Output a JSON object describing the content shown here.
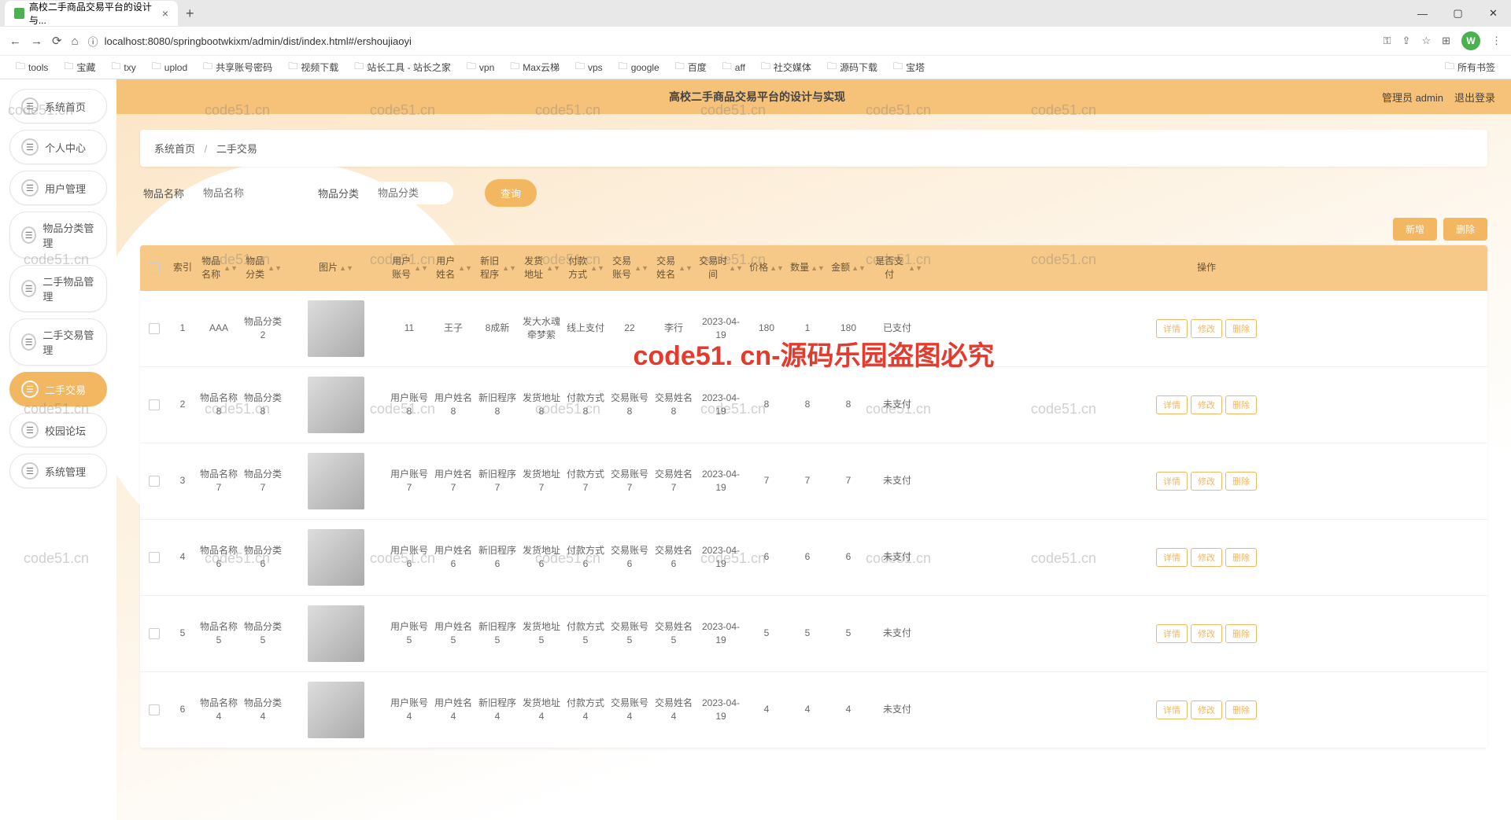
{
  "browser": {
    "tab_title": "高校二手商品交易平台的设计与...",
    "new_tab": "+",
    "url": "localhost:8080/springbootwkixm/admin/dist/index.html#/ershoujiaoyi",
    "avatar_letter": "W",
    "bookmarks": [
      "tools",
      "宝藏",
      "txy",
      "uplod",
      "共享账号密码",
      "视频下载",
      "站长工具 - 站长之家",
      "vpn",
      "Max云梯",
      "vps",
      "google",
      "百度",
      "aff",
      "社交媒体",
      "源码下载",
      "宝塔"
    ],
    "all_bookmarks": "所有书签"
  },
  "header": {
    "title": "高校二手商品交易平台的设计与实现",
    "admin_label": "管理员 admin",
    "logout": "退出登录"
  },
  "sidebar": {
    "items": [
      {
        "label": "系统首页"
      },
      {
        "label": "个人中心"
      },
      {
        "label": "用户管理"
      },
      {
        "label": "物品分类管理"
      },
      {
        "label": "二手物品管理"
      },
      {
        "label": "二手交易管理"
      },
      {
        "label": "二手交易"
      },
      {
        "label": "校园论坛"
      },
      {
        "label": "系统管理"
      }
    ],
    "active_index": 6
  },
  "breadcrumb": {
    "home": "系统首页",
    "current": "二手交易",
    "sep": "/"
  },
  "filters": {
    "name_label": "物品名称",
    "name_placeholder": "物品名称",
    "cat_label": "物品分类",
    "cat_placeholder": "物品分类",
    "search": "查询"
  },
  "actions": {
    "add": "新增",
    "delete": "删除"
  },
  "table": {
    "cols": {
      "idx": "索引",
      "name": "物品名称",
      "cat": "物品分类",
      "img": "图片",
      "acc": "用户账号",
      "uname": "用户姓名",
      "cond": "新旧程序",
      "addr": "发货地址",
      "pay": "付款方式",
      "tacc": "交易账号",
      "tname": "交易姓名",
      "time": "交易时间",
      "price": "价格",
      "qty": "数量",
      "amt": "金额",
      "paid": "是否支付",
      "op": "操作"
    },
    "op_btns": {
      "detail": "详情",
      "edit": "修改",
      "del": "删除"
    },
    "rows": [
      {
        "idx": "1",
        "name": "AAA",
        "cat": "物品分类2",
        "acc": "11",
        "uname": "王子",
        "cond": "8成新",
        "addr": "发大水魂牵梦萦",
        "pay": "线上支付",
        "tacc": "22",
        "tname": "李行",
        "time": "2023-04-19",
        "price": "180",
        "qty": "1",
        "amt": "180",
        "paid": "已支付"
      },
      {
        "idx": "2",
        "name": "物品名称8",
        "cat": "物品分类8",
        "acc": "用户账号8",
        "uname": "用户姓名8",
        "cond": "新旧程序8",
        "addr": "发货地址8",
        "pay": "付款方式8",
        "tacc": "交易账号8",
        "tname": "交易姓名8",
        "time": "2023-04-19",
        "price": "8",
        "qty": "8",
        "amt": "8",
        "paid": "未支付"
      },
      {
        "idx": "3",
        "name": "物品名称7",
        "cat": "物品分类7",
        "acc": "用户账号7",
        "uname": "用户姓名7",
        "cond": "新旧程序7",
        "addr": "发货地址7",
        "pay": "付款方式7",
        "tacc": "交易账号7",
        "tname": "交易姓名7",
        "time": "2023-04-19",
        "price": "7",
        "qty": "7",
        "amt": "7",
        "paid": "未支付"
      },
      {
        "idx": "4",
        "name": "物品名称6",
        "cat": "物品分类6",
        "acc": "用户账号6",
        "uname": "用户姓名6",
        "cond": "新旧程序6",
        "addr": "发货地址6",
        "pay": "付款方式6",
        "tacc": "交易账号6",
        "tname": "交易姓名6",
        "time": "2023-04-19",
        "price": "6",
        "qty": "6",
        "amt": "6",
        "paid": "未支付"
      },
      {
        "idx": "5",
        "name": "物品名称5",
        "cat": "物品分类5",
        "acc": "用户账号5",
        "uname": "用户姓名5",
        "cond": "新旧程序5",
        "addr": "发货地址5",
        "pay": "付款方式5",
        "tacc": "交易账号5",
        "tname": "交易姓名5",
        "time": "2023-04-19",
        "price": "5",
        "qty": "5",
        "amt": "5",
        "paid": "未支付"
      },
      {
        "idx": "6",
        "name": "物品名称4",
        "cat": "物品分类4",
        "acc": "用户账号4",
        "uname": "用户姓名4",
        "cond": "新旧程序4",
        "addr": "发货地址4",
        "pay": "付款方式4",
        "tacc": "交易账号4",
        "tname": "交易姓名4",
        "time": "2023-04-19",
        "price": "4",
        "qty": "4",
        "amt": "4",
        "paid": "未支付"
      }
    ]
  },
  "watermark": {
    "banner": "code51. cn-源码乐园盗图必究",
    "small": "code51.cn"
  }
}
